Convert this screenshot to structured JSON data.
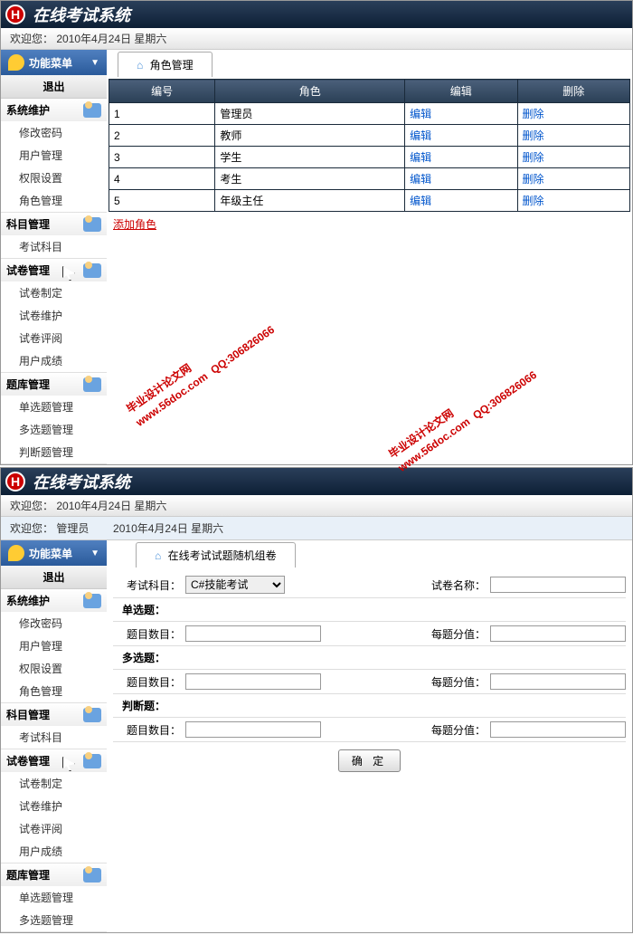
{
  "app_title": "在线考试系统",
  "welcome_prefix": "欢迎您：",
  "date": "2010年4月24日 星期六",
  "user_role": "管理员",
  "menu_title": "功能菜单",
  "exit": "退出",
  "groups": [
    {
      "name": "系统维护",
      "items": [
        "修改密码",
        "用户管理",
        "权限设置",
        "角色管理"
      ]
    },
    {
      "name": "科目管理",
      "items": [
        "考试科目"
      ]
    },
    {
      "name": "试卷管理",
      "items": [
        "试卷制定",
        "试卷维护",
        "试卷评阅",
        "用户成绩"
      ]
    },
    {
      "name": "题库管理",
      "items": [
        "单选题管理",
        "多选题管理",
        "判断题管理"
      ]
    }
  ],
  "groups2": [
    {
      "name": "系统维护",
      "items": [
        "修改密码",
        "用户管理",
        "权限设置",
        "角色管理"
      ]
    },
    {
      "name": "科目管理",
      "items": [
        "考试科目"
      ]
    },
    {
      "name": "试卷管理",
      "items": [
        "试卷制定",
        "试卷维护",
        "试卷评阅",
        "用户成绩"
      ]
    },
    {
      "name": "题库管理",
      "items": [
        "单选题管理",
        "多选题管理"
      ]
    }
  ],
  "tab1": "角色管理",
  "cols": [
    "编号",
    "角色",
    "编辑",
    "删除"
  ],
  "rows": [
    {
      "id": "1",
      "role": "管理员"
    },
    {
      "id": "2",
      "role": "教师"
    },
    {
      "id": "3",
      "role": "学生"
    },
    {
      "id": "4",
      "role": "考生"
    },
    {
      "id": "5",
      "role": "年级主任"
    }
  ],
  "edit": "编辑",
  "del": "删除",
  "add_role": "添加角色",
  "tab2": "在线考试试题随机组卷",
  "form": {
    "subject_lbl": "考试科目：",
    "subject_val": "C#技能考试",
    "name_lbl": "试卷名称：",
    "single": "单选题：",
    "multi": "多选题：",
    "judge": "判断题：",
    "count_lbl": "题目数目：",
    "score_lbl": "每题分值：",
    "submit": "确 定"
  },
  "watermark": {
    "l1": "毕业设计论文网",
    "l2": "www.56doc.com",
    "l3": "QQ:306826066"
  }
}
